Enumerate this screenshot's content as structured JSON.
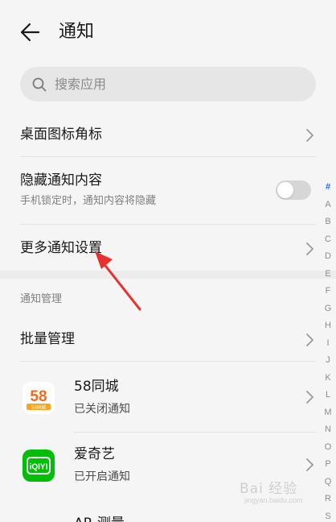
{
  "header": {
    "title": "通知",
    "back_icon": "arrow-left-icon"
  },
  "search": {
    "placeholder": "搜索应用",
    "icon": "search-icon"
  },
  "settings": {
    "desktop_badge": {
      "title": "桌面图标角标"
    },
    "hide_content": {
      "title": "隐藏通知内容",
      "subtitle": "手机锁定时，通知内容将隐藏",
      "enabled": false
    },
    "more_settings": {
      "title": "更多通知设置"
    }
  },
  "management": {
    "section_label": "通知管理",
    "batch": {
      "title": "批量管理"
    },
    "apps": [
      {
        "name": "58同城",
        "status": "已关闭通知",
        "icon_text": "58",
        "icon_subtext": "58同城",
        "icon_name": "58tongcheng-app-icon"
      },
      {
        "name": "爱奇艺",
        "status": "已开启通知",
        "icon_text": "iQIYI",
        "icon_name": "iqiyi-app-icon"
      },
      {
        "name": "AR 测量"
      }
    ]
  },
  "index_bar": {
    "letters": [
      "#",
      "A",
      "B",
      "C",
      "D",
      "E",
      "F",
      "G",
      "H",
      "I",
      "J",
      "K",
      "L",
      "M",
      "N",
      "O",
      "P",
      "Q",
      "R",
      "S"
    ],
    "active": "#"
  },
  "annotation": {
    "color": "#e8312f"
  },
  "watermark": {
    "main": "Bai 经验",
    "sub": "jingyan.baidu.com"
  },
  "colors": {
    "background": "#f5f5f5",
    "accent": "#1f6fe6",
    "toggle_off": "#d6d6d6",
    "iqiyi_green": "#00be06"
  }
}
